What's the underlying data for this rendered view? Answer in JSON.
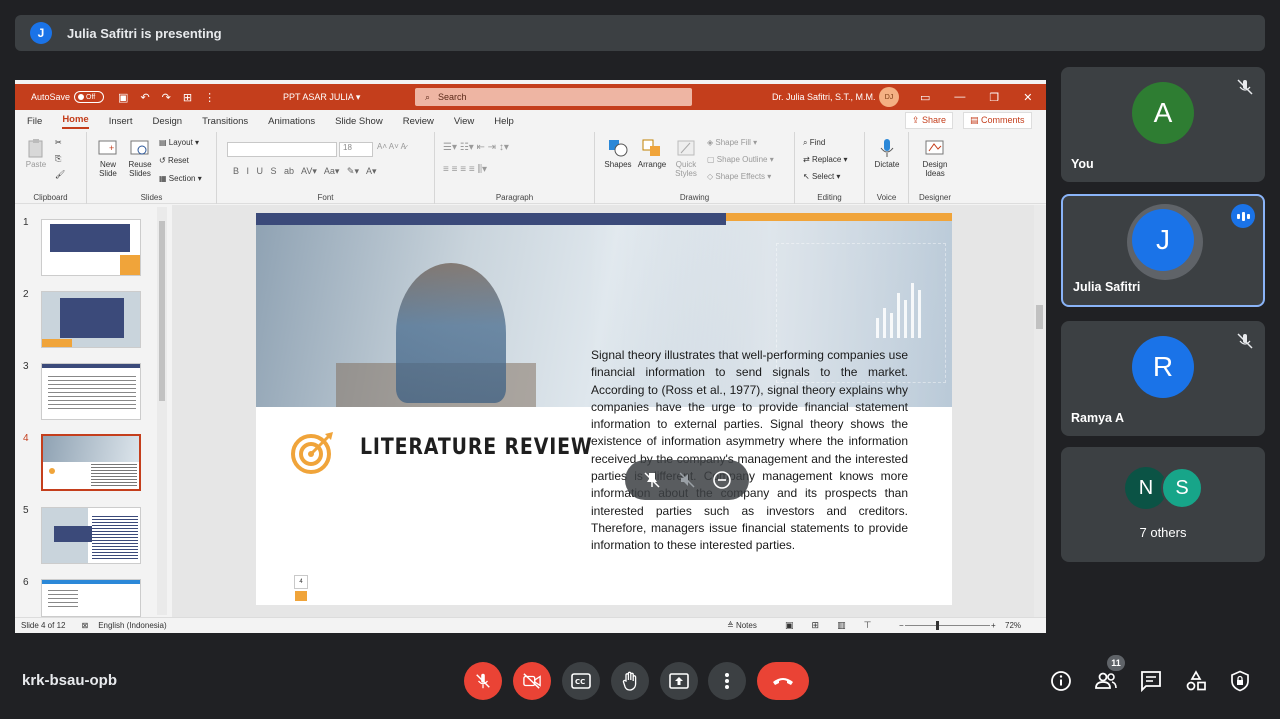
{
  "banner": {
    "avatar_letter": "J",
    "text": "Julia Safitri is presenting"
  },
  "ppt": {
    "autosave_label": "AutoSave",
    "autosave_state": "Off",
    "doc_title": "PPT ASAR JULIA",
    "search_placeholder": "Search",
    "user_name": "Dr. Julia Safitri, S.T., M.M.",
    "user_initials": "DJ",
    "menu": [
      "File",
      "Home",
      "Insert",
      "Design",
      "Transitions",
      "Animations",
      "Slide Show",
      "Review",
      "View",
      "Help"
    ],
    "share_label": "Share",
    "comments_label": "Comments",
    "ribbon": {
      "clipboard": {
        "paste": "Paste",
        "group": "Clipboard"
      },
      "slides": {
        "new_slide": "New Slide",
        "reuse_slides": "Reuse Slides",
        "layout": "Layout",
        "reset": "Reset",
        "section": "Section",
        "group": "Slides"
      },
      "font": {
        "size": "18",
        "group": "Font"
      },
      "paragraph": {
        "group": "Paragraph"
      },
      "drawing": {
        "shapes": "Shapes",
        "arrange": "Arrange",
        "quick_styles": "Quick Styles",
        "shape_fill": "Shape Fill",
        "shape_outline": "Shape Outline",
        "shape_effects": "Shape Effects",
        "group": "Drawing"
      },
      "editing": {
        "find": "Find",
        "replace": "Replace",
        "select": "Select",
        "group": "Editing"
      },
      "voice": {
        "dictate": "Dictate",
        "group": "Voice"
      },
      "designer": {
        "design_ideas": "Design Ideas",
        "group": "Designer"
      }
    },
    "thumbnails": [
      "1",
      "2",
      "3",
      "4",
      "5",
      "6"
    ],
    "active_slide": 4,
    "slide": {
      "title": "LITERATURE REVIEW",
      "body": "Signal theory illustrates that well-performing companies use financial information to send signals to the market. According to (Ross et al., 1977), signal theory explains why companies have the urge to provide financial statement information to external parties. Signal theory shows the existence of information asymmetry where the information received by the company's management and the interested parties is different. Company management knows more information about the company and its prospects than interested parties such as investors and creditors. Therefore, managers issue financial statements to provide information to these interested parties.",
      "page_number": "4"
    },
    "status": {
      "slide_counter": "Slide 4 of 12",
      "language": "English (Indonesia)",
      "notes": "Notes",
      "zoom": "72%"
    }
  },
  "participants": [
    {
      "name": "You",
      "initial": "A",
      "color": "#2e7d32",
      "muted": true
    },
    {
      "name": "Julia Safitri",
      "initial": "J",
      "color": "#1a73e8",
      "speaking": true
    },
    {
      "name": "Ramya A",
      "initial": "R",
      "color": "#1a73e8",
      "muted": true
    },
    {
      "name": "7 others",
      "initials": [
        "N",
        "S"
      ],
      "colors": [
        "#0b5345",
        "#17a589"
      ]
    }
  ],
  "bottom": {
    "meeting_code": "krk-bsau-opb",
    "participant_count": "11"
  },
  "colors": {
    "ppt_accent": "#c43e1c",
    "meet_red": "#ea4335",
    "meet_bg": "#202124",
    "tile_bg": "#3c4043"
  }
}
